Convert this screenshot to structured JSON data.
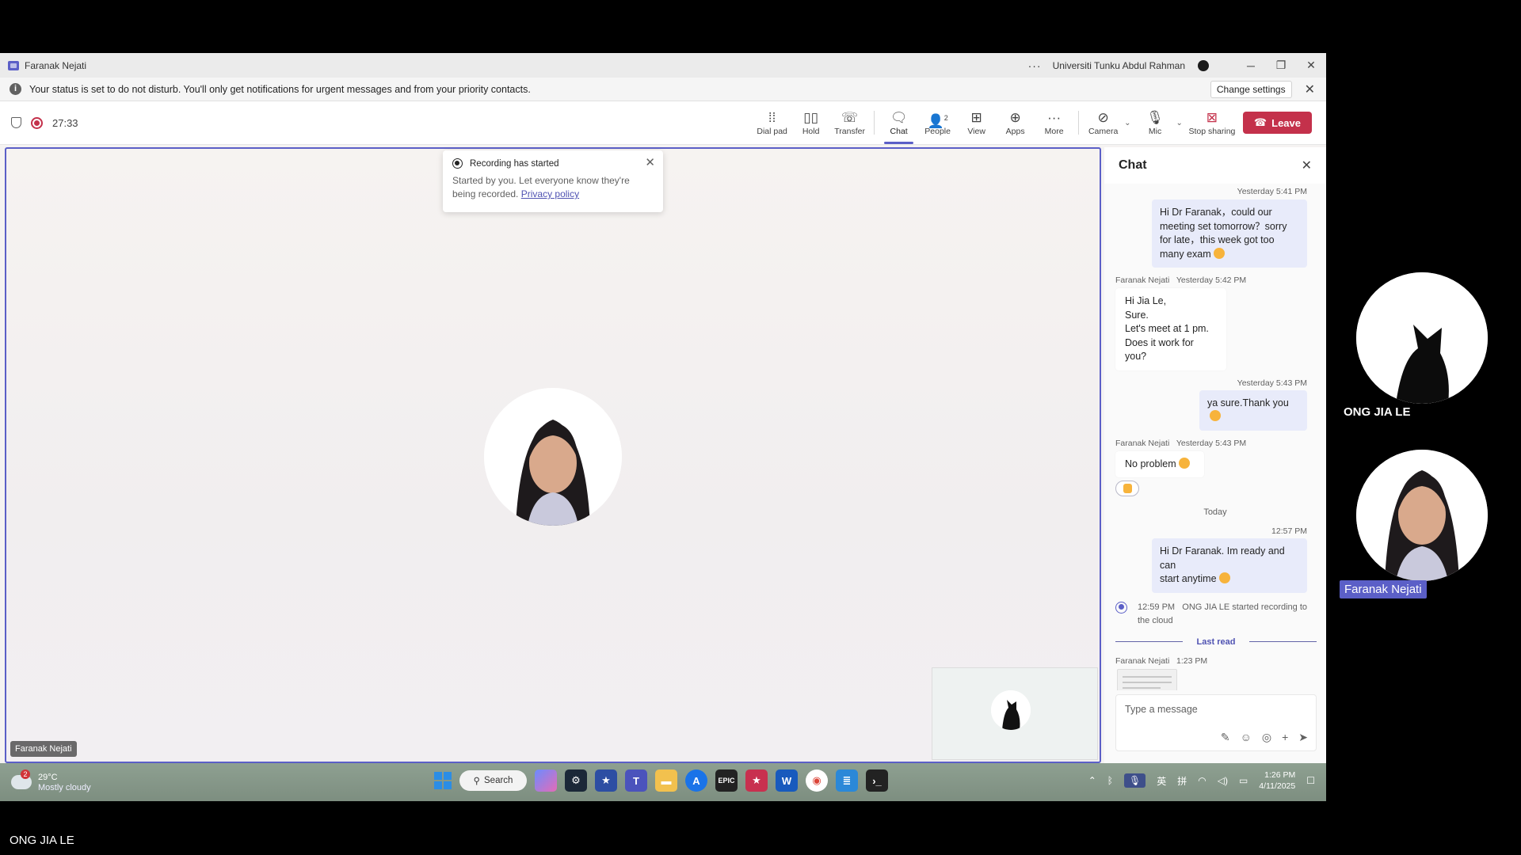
{
  "window": {
    "title": "Faranak Nejati",
    "more": "···",
    "org": "Universiti Tunku Abdul Rahman",
    "minimize": "─",
    "maximize": "❐",
    "close": "✕"
  },
  "banner": {
    "text": "Your status is set to do not disturb. You'll only get notifications for urgent messages and from your priority contacts.",
    "change_settings": "Change settings",
    "close": "✕"
  },
  "meeting": {
    "timer": "27:33"
  },
  "toolbar": {
    "dial_pad": "Dial pad",
    "hold": "Hold",
    "transfer": "Transfer",
    "chat": "Chat",
    "people": "People",
    "people_count": "2",
    "view": "View",
    "apps": "Apps",
    "more": "More",
    "camera": "Camera",
    "mic": "Mic",
    "stop_sharing": "Stop sharing",
    "leave": "Leave"
  },
  "toast": {
    "title": "Recording has started",
    "body": "Started by you. Let everyone know they're being recorded.",
    "link": "Privacy policy",
    "close": "✕"
  },
  "stage": {
    "speaker_name": "Faranak Nejati"
  },
  "chat": {
    "title": "Chat",
    "close": "✕",
    "messages": [
      {
        "meta": "Yesterday 5:41 PM",
        "lines": [
          "Hi Dr Faranak，could our",
          "meeting set tomorrow？sorry",
          "for late，this week got too",
          "many exam"
        ]
      },
      {
        "sender": "Faranak Nejati",
        "meta": "Yesterday 5:42 PM",
        "lines": [
          "Hi Jia Le,",
          "Sure.",
          "Let's meet at 1 pm.",
          "Does it work for you?"
        ]
      },
      {
        "meta": "Yesterday 5:43 PM",
        "lines": [
          "ya sure.Thank you"
        ]
      },
      {
        "sender": "Faranak Nejati",
        "meta": "Yesterday 5:43 PM",
        "lines": [
          "No problem"
        ]
      }
    ],
    "day_separator": "Today",
    "today_msg": {
      "meta": "12:57 PM",
      "lines": [
        "Hi Dr Faranak. Im ready and can",
        "start anytime"
      ]
    },
    "system": {
      "time": "12:59 PM",
      "text": "ONG JIA LE started recording to",
      "text2": "the cloud"
    },
    "last_read": "Last read",
    "file_msg": {
      "sender": "Faranak Nejati",
      "time": "1:23 PM"
    },
    "composer_placeholder": "Type a message"
  },
  "taskbar": {
    "temp": "29°C",
    "weather": "Mostly cloudy",
    "weather_badge": "2",
    "search": "Search",
    "time": "1:26 PM",
    "date": "4/11/2025",
    "ime1": "英",
    "ime2": "拼"
  },
  "gallery": {
    "participant1": "ONG JIA LE",
    "participant2": "Faranak Nejati",
    "bottom_name": "ONG JIA LE"
  }
}
